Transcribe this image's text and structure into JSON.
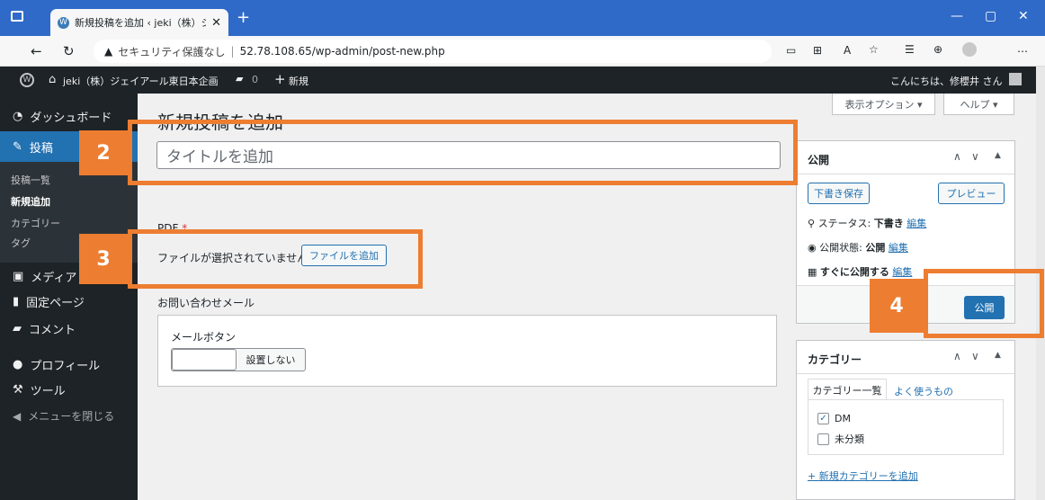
{
  "browser": {
    "tab_title": "新規投稿を追加 ‹ jeki（株）ジェイ",
    "security_text": "セキュリティ保護なし",
    "url": "52.78.108.65/wp-admin/post-new.php"
  },
  "adminbar": {
    "site_name": "jeki（株）ジェイアール東日本企画",
    "comments_count": "0",
    "new_label": "新規",
    "greeting": "こんにちは、修櫻井 さん"
  },
  "sidebar": {
    "dashboard": "ダッシュボード",
    "posts": "投稿",
    "sub_all": "投稿一覧",
    "sub_new": "新規追加",
    "sub_category": "カテゴリー",
    "sub_tag": "タグ",
    "media": "メディア",
    "pages": "固定ページ",
    "comments": "コメント",
    "profile": "プロフィール",
    "tools": "ツール",
    "collapse": "メニューを閉じる"
  },
  "main": {
    "page_title": "新規投稿を追加",
    "screen_options": "表示オプション ▾",
    "help": "ヘルプ ▾",
    "title_placeholder": "タイトルを追加",
    "pdf_label": "PDF",
    "pdf_required": "*",
    "no_file": "ファイルが選択されていません",
    "add_file": "ファイルを追加",
    "contact_label": "お問い合わせメール",
    "mail_button_label": "メールボタン",
    "no_setting": "設置しない"
  },
  "publish": {
    "heading": "公開",
    "save_draft": "下書き保存",
    "preview": "プレビュー",
    "status_label": "ステータス:",
    "status_value": "下書き",
    "visibility_label": "公開状態:",
    "visibility_value": "公開",
    "schedule_label": "すぐに公開する",
    "edit": "編集",
    "publish_button": "公開"
  },
  "category": {
    "heading": "カテゴリー",
    "tab_all": "カテゴリー一覧",
    "tab_popular": "よく使うもの",
    "items": [
      {
        "label": "DM",
        "checked": true
      },
      {
        "label": "未分類",
        "checked": false
      }
    ],
    "add_new": "+ 新規カテゴリーを追加"
  },
  "annotations": {
    "step2": "2",
    "step3": "3",
    "step4": "4"
  },
  "colors": {
    "annotation": "#ed7d31",
    "wp_blue": "#2271b1",
    "admin_dark": "#1d2327",
    "browser_blue": "#2f6ac8"
  }
}
